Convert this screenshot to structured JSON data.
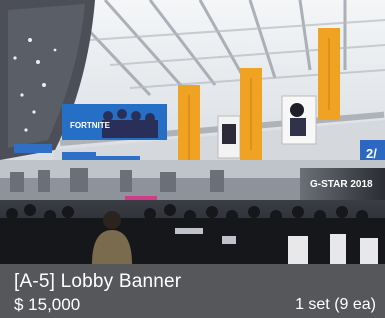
{
  "product": {
    "title": "[A-5] Lobby Banner",
    "price": "$ 15,000",
    "quantity": "1 set (9 ea)"
  },
  "photo": {
    "billboard_game_text": "FORTNITE",
    "event_sign_text": "G-STAR 2018",
    "wall_sign_text": "2/",
    "banner_color": "#f0a323",
    "caption_background": "#55575a"
  }
}
